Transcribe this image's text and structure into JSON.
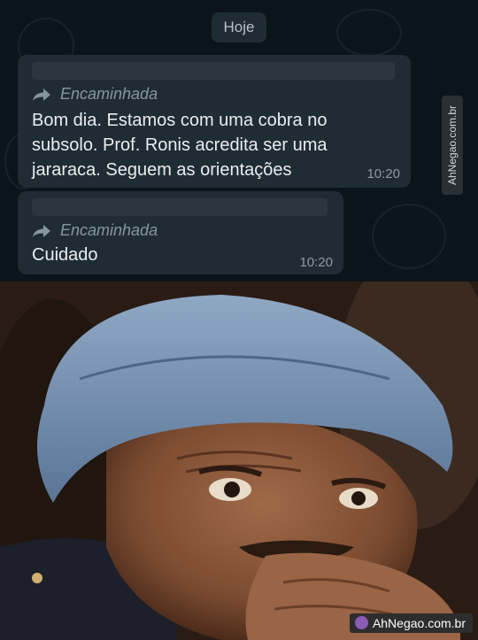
{
  "chat": {
    "date_chip": "Hoje",
    "forward_icon": "forward-arrow-icon",
    "messages": [
      {
        "forwarded_label": "Encaminhada",
        "lines": [
          "Bom dia. Estamos com uma cobra no",
          "subsolo. Prof. Ronis acredita ser uma",
          "jararaca. Seguem as orientações"
        ],
        "time": "10:20"
      },
      {
        "forwarded_label": "Encaminhada",
        "lines": [
          "Cuidado"
        ],
        "time": "10:20"
      }
    ],
    "side_watermark": "AhNegao.com.br"
  },
  "photo": {
    "description_icon": "man-in-blue-hat-photo",
    "watermark": "AhNegao.com.br"
  },
  "colors": {
    "chat_bg": "#0b141a",
    "bubble": "#202c33",
    "text": "#e9edef",
    "meta": "#8696a0",
    "hat": "#6f8fb0",
    "skin": "#8a5a3c"
  }
}
